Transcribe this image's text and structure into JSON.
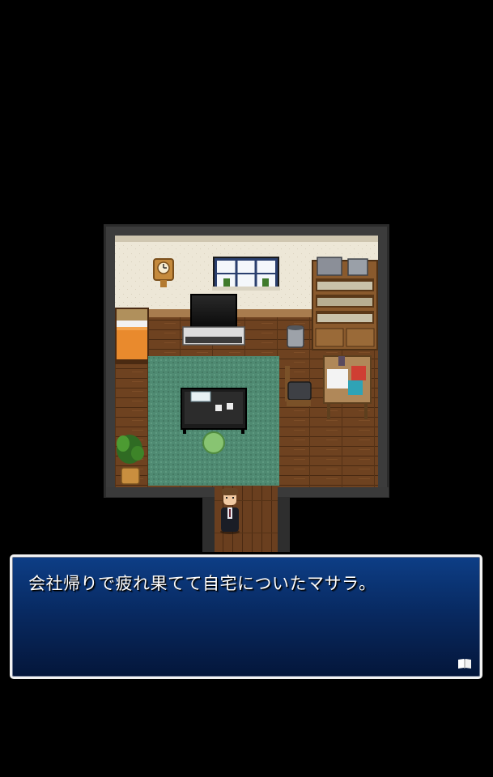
{
  "message_window": {
    "text": "会社帰りで疲れ果てて自宅についたマサラ。",
    "advance_icon": "open-book-icon"
  },
  "scene": {
    "location": "player-home-living-room",
    "player_character": "salaryman-in-dark-suit",
    "wall_clock_icon": "pendulum-clock-icon"
  },
  "colors": {
    "window_top": "#0d3e86",
    "window_bottom": "#04163a",
    "window_border": "#f2f2f2",
    "floor": "#6a3f1f",
    "rug": "#4f8a72",
    "wall": "#ece6d6"
  }
}
